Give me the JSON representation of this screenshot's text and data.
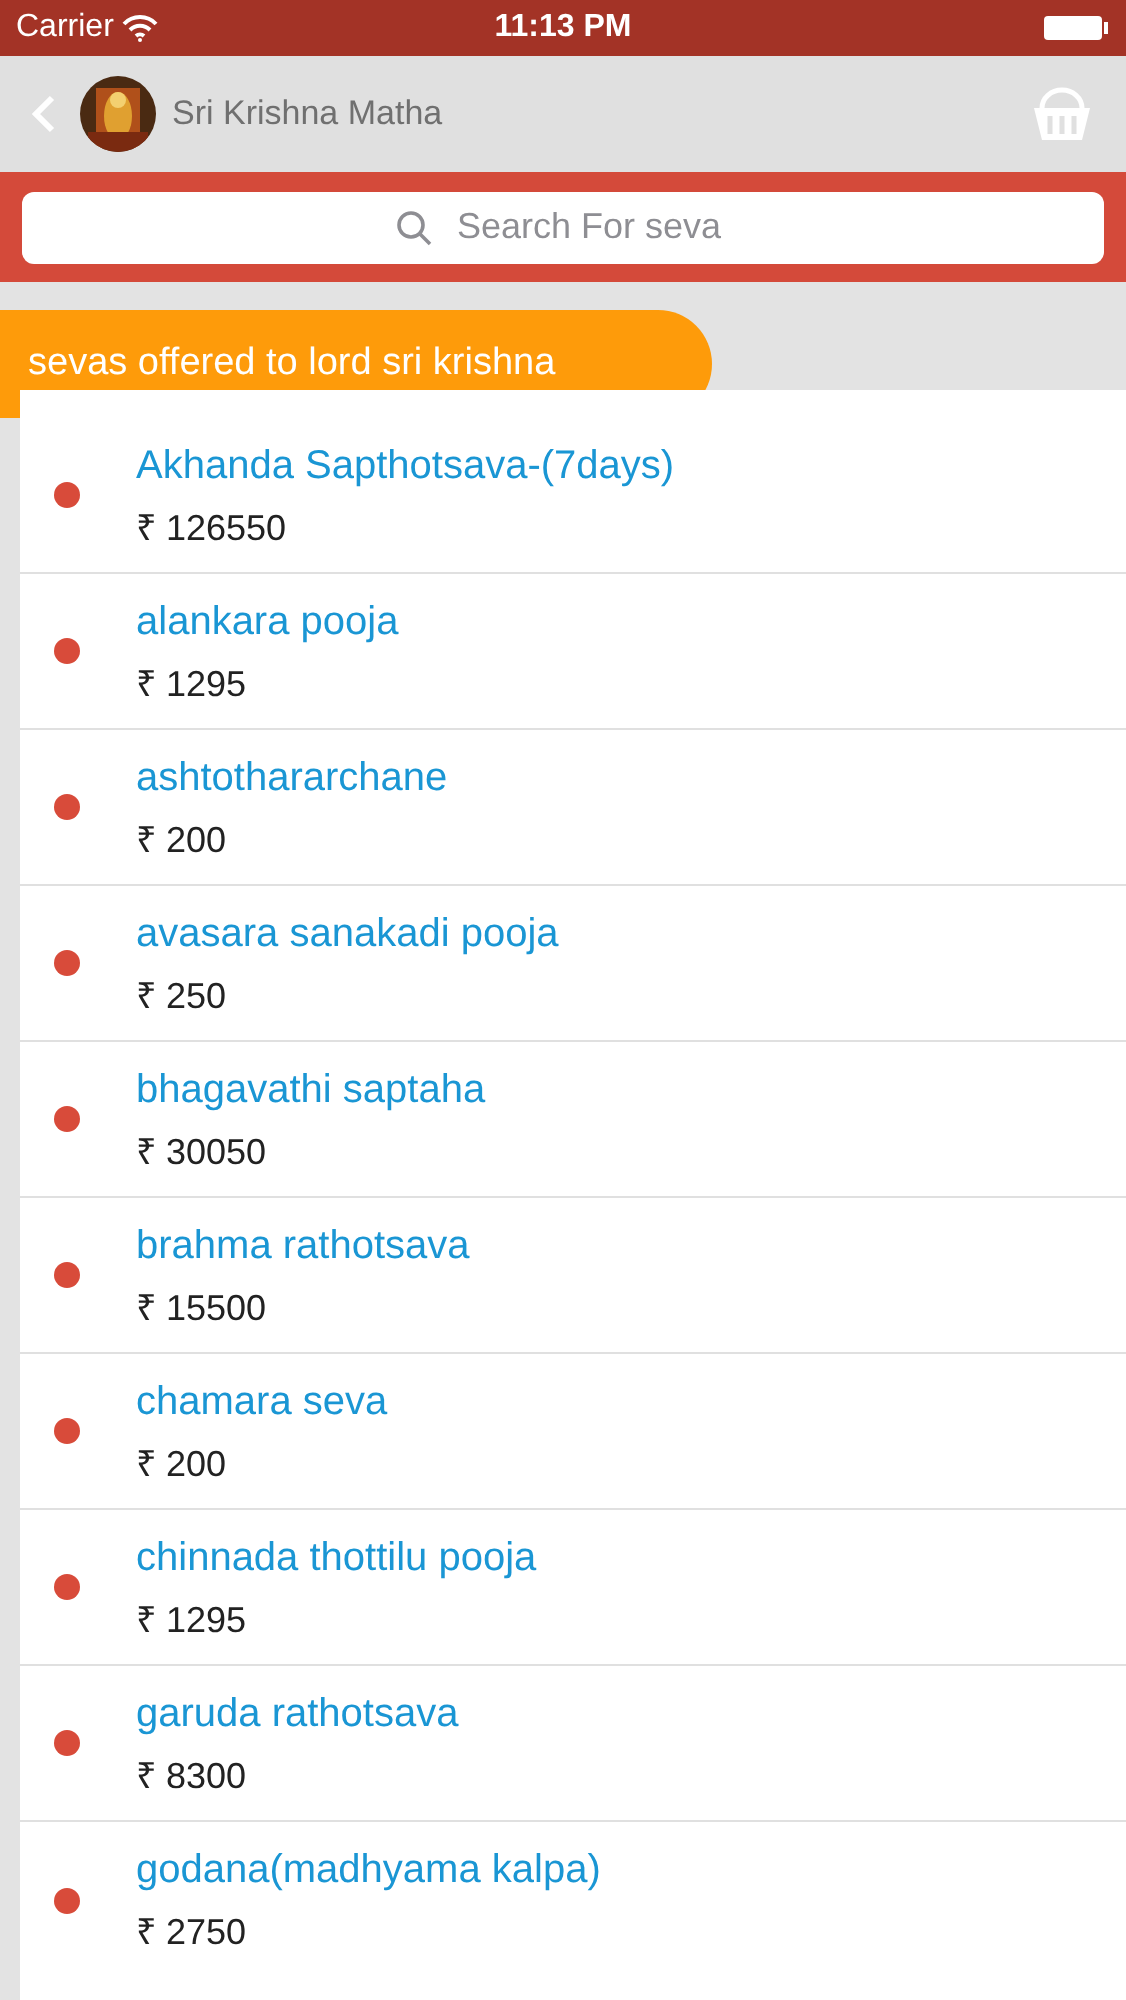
{
  "status_bar": {
    "carrier": "Carrier",
    "time": "11:13 PM"
  },
  "nav_bar": {
    "title": "Sri Krishna Matha"
  },
  "search": {
    "placeholder": "Search For seva"
  },
  "section": {
    "title": "sevas offered to lord sri krishna"
  },
  "sevas": [
    {
      "name": "Akhanda Sapthotsava-(7days)",
      "price": "₹ 126550",
      "color": "#d84b3a"
    },
    {
      "name": "alankara pooja",
      "price": "₹ 1295",
      "color": "#d84b3a"
    },
    {
      "name": "ashtothararchane",
      "price": "₹ 200",
      "color": "#d84b3a"
    },
    {
      "name": "avasara sanakadi pooja",
      "price": "₹ 250",
      "color": "#d84b3a"
    },
    {
      "name": "bhagavathi saptaha",
      "price": "₹ 30050",
      "color": "#d84b3a"
    },
    {
      "name": "brahma rathotsava",
      "price": "₹ 15500",
      "color": "#d84b3a"
    },
    {
      "name": "chamara seva",
      "price": "₹ 200",
      "color": "#d84b3a"
    },
    {
      "name": "chinnada thottilu pooja",
      "price": "₹ 1295",
      "color": "#d84b3a"
    },
    {
      "name": "garuda rathotsava",
      "price": "₹ 8300",
      "color": "#d84b3a"
    },
    {
      "name": "godana(madhyama kalpa)",
      "price": "₹ 2750",
      "color": "#d84b3a"
    }
  ]
}
